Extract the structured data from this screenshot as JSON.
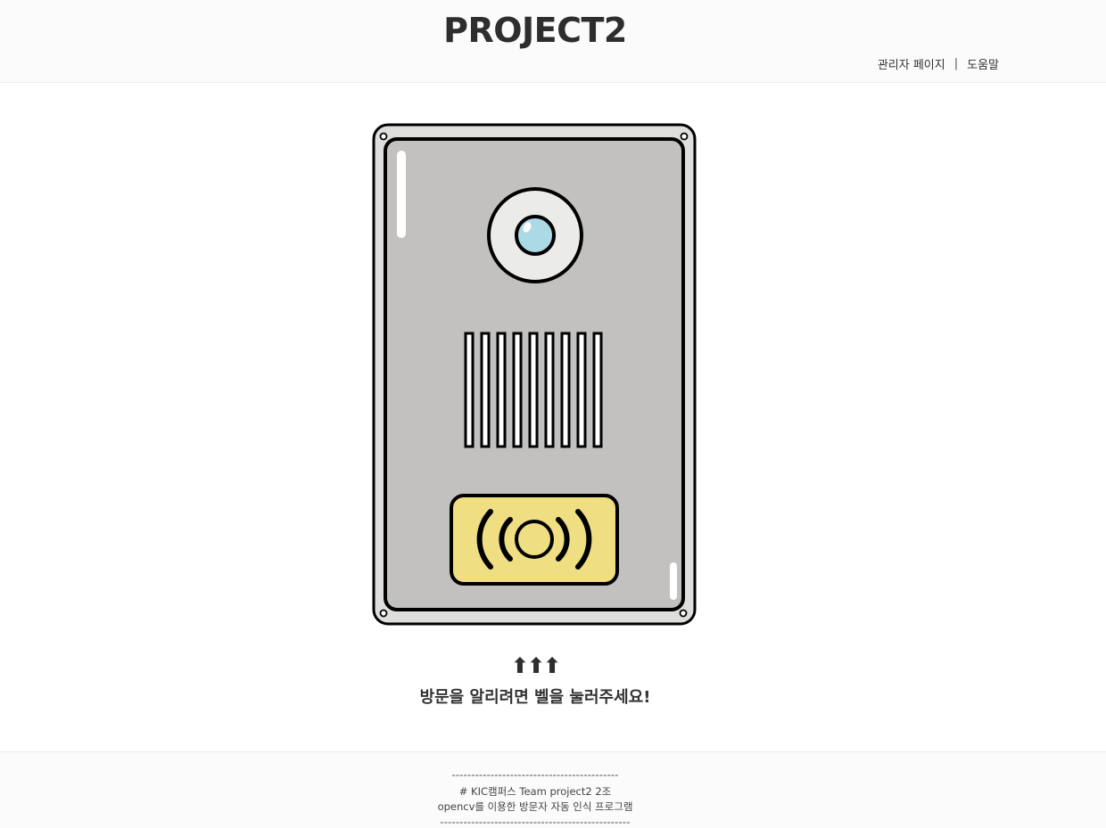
{
  "header": {
    "title": "PROJECT2",
    "links": {
      "admin": "관리자 페이지",
      "separator": "|",
      "help": "도움말"
    }
  },
  "doorbell": {
    "camera_icon": "camera-lens-icon",
    "speaker_icon": "speaker-grille-icon",
    "button_icon": "ring-signal-icon",
    "colors": {
      "panel": "#c2c1bf",
      "frame": "#dededd",
      "button": "#f0de82",
      "lens": "#acd9e6",
      "camera_ring": "#ebebea"
    }
  },
  "prompt": {
    "arrows": "⬆⬆⬆",
    "message": "방문을 알리려면 벨을 눌러주세요!"
  },
  "footer": {
    "divider_top": "-------------------------------------------",
    "team": "# KIC캠퍼스 Team project2 2조",
    "description": "opencv를 이용한 방문자 자동 인식 프로그램",
    "divider_bottom": "-------------------------------------------------"
  }
}
